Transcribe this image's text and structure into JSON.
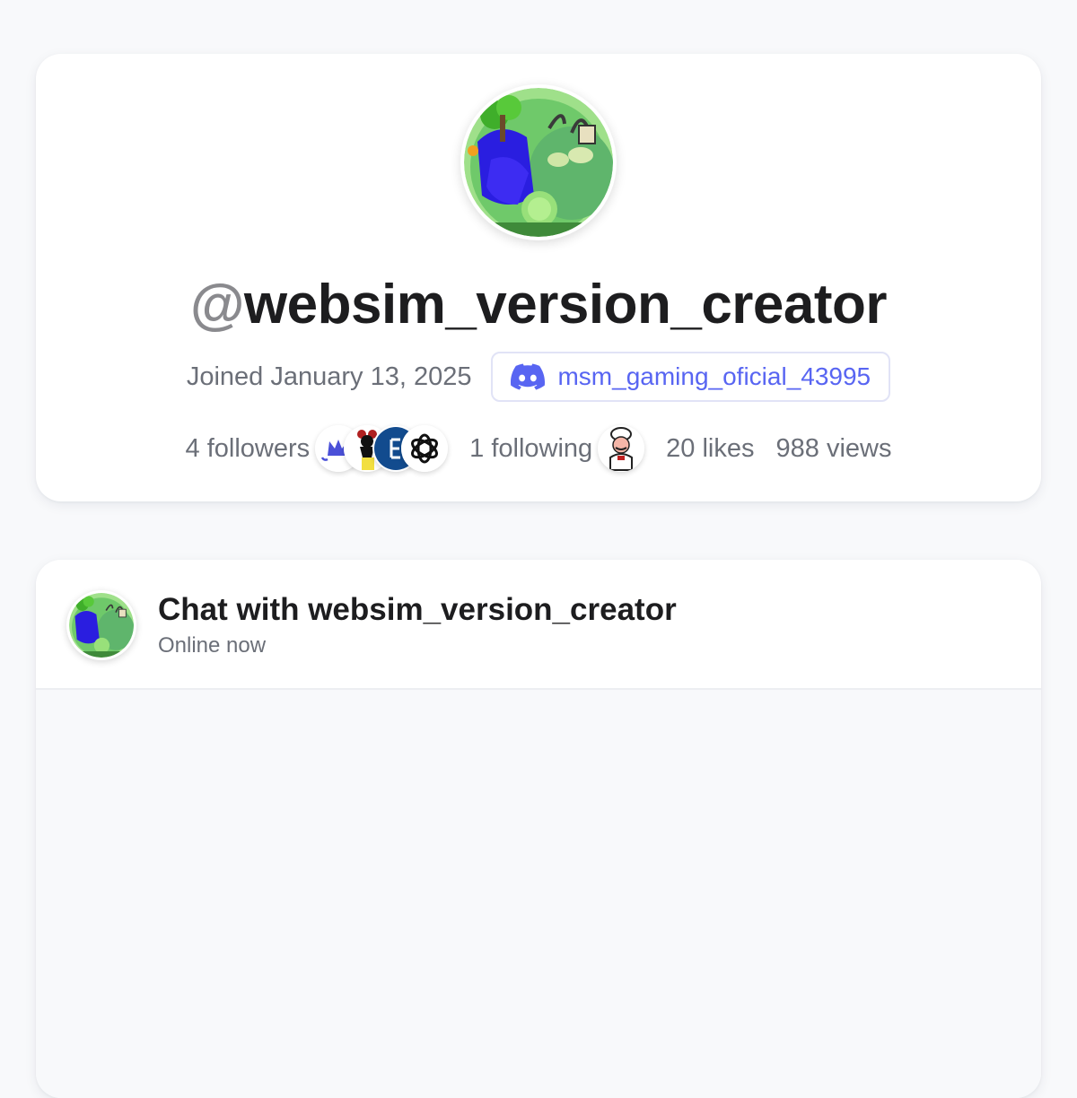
{
  "profile": {
    "avatar_icon": "planet-island-avatar-icon",
    "username_at": "@",
    "username": "websim_version_creator",
    "joined": "Joined January 13, 2025",
    "discord": {
      "icon": "discord-icon",
      "handle": "msm_gaming_oficial_43995",
      "color": "#5865f2"
    }
  },
  "stats": {
    "followers_label": "4 followers",
    "follower_avatars": [
      "crown-avatar-icon",
      "mouse-avatar-icon",
      "e-logo-avatar-icon",
      "openai-logo-avatar-icon"
    ],
    "following_label": "1 following",
    "following_avatars": [
      "chef-avatar-icon"
    ],
    "likes_label": "20 likes",
    "views_label": "988 views"
  },
  "chat": {
    "title": "Chat with websim_version_creator",
    "status": "Online now"
  },
  "colors": {
    "page_background": "#f8f9fb",
    "card_background": "#ffffff",
    "muted_text": "#6b6f78",
    "accent": "#5865f2"
  }
}
